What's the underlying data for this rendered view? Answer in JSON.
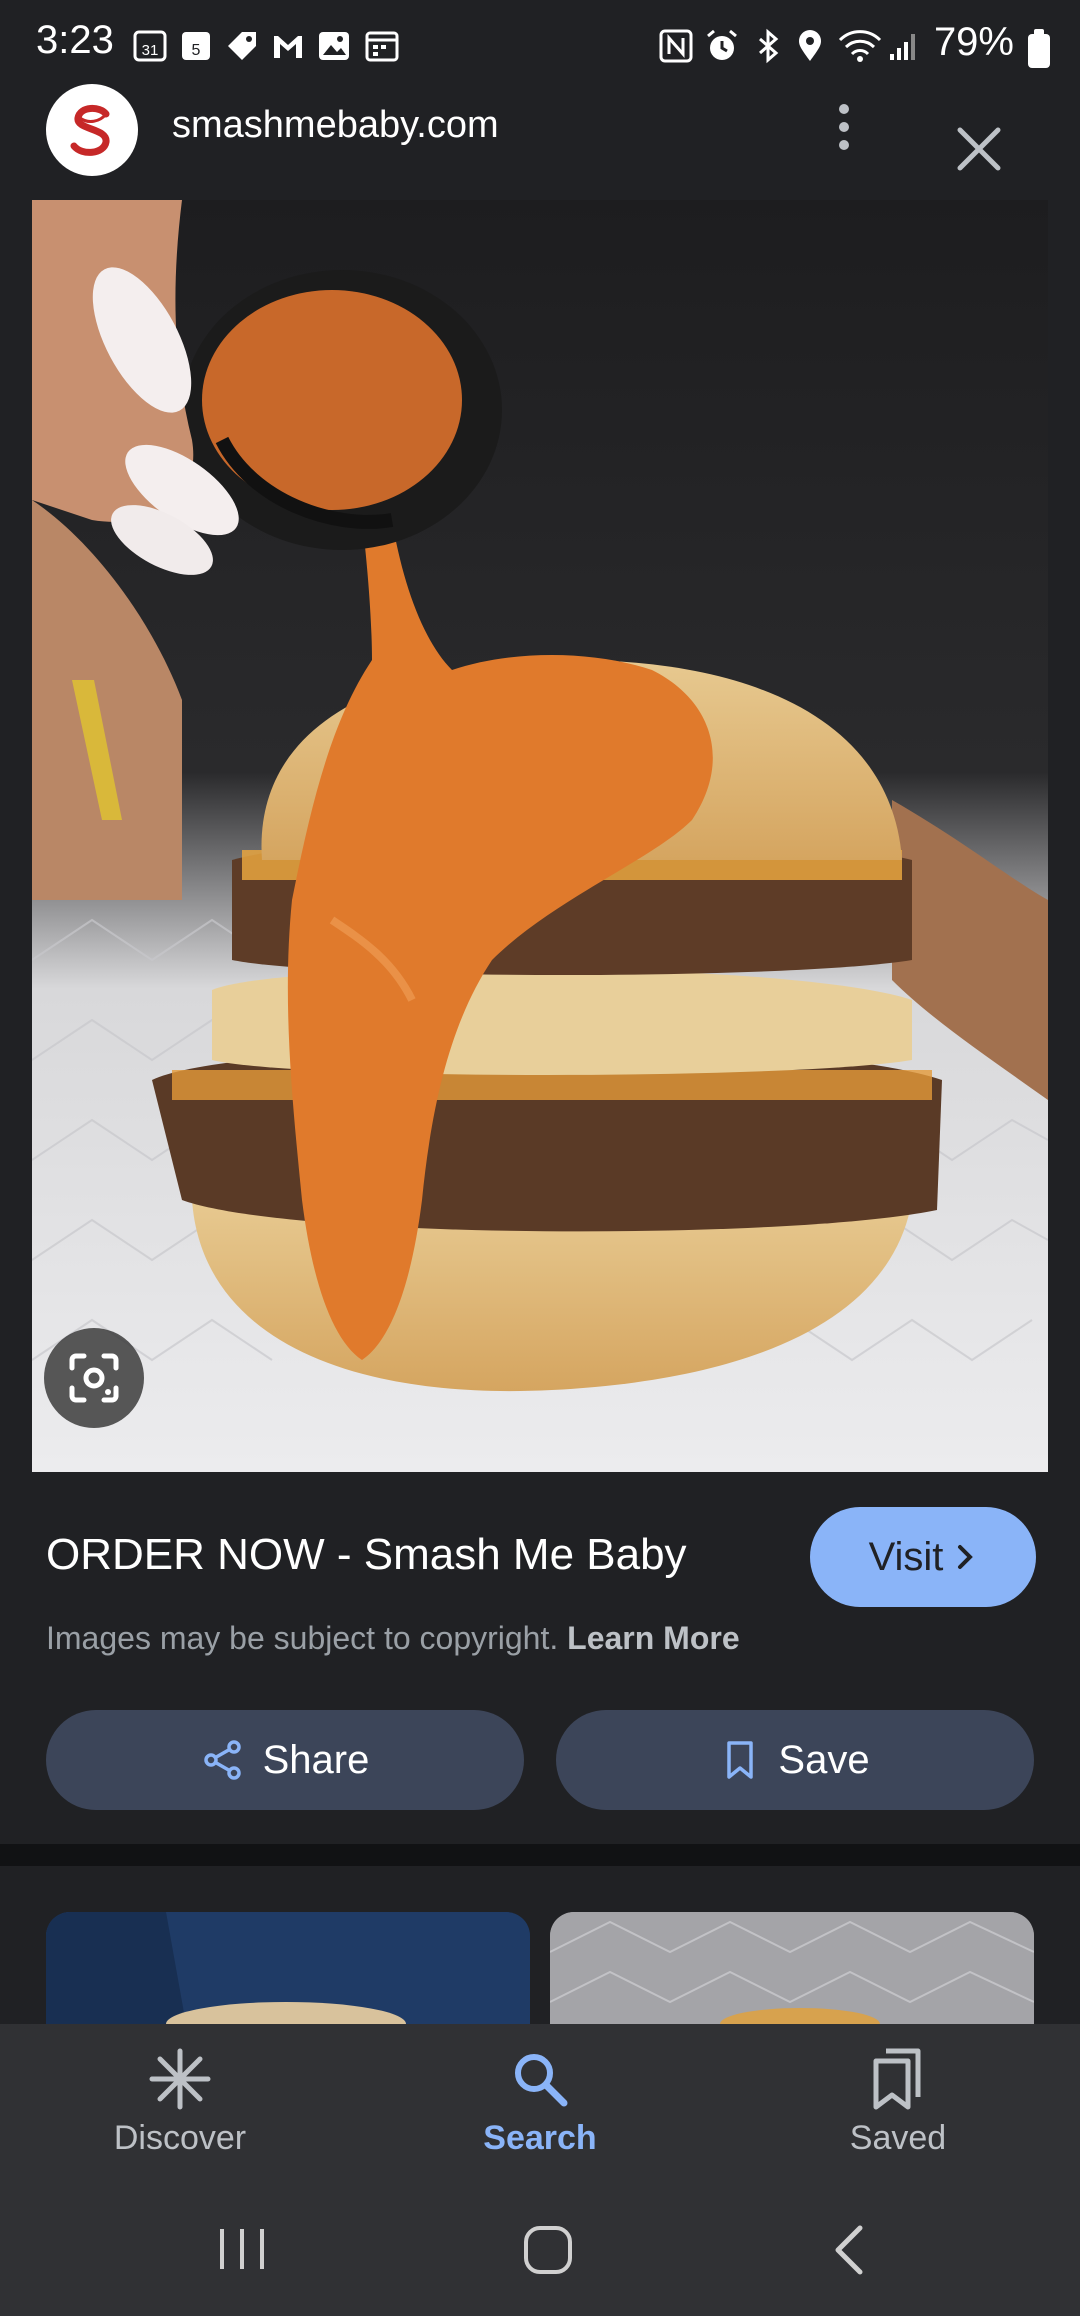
{
  "status_bar": {
    "time": "3:23",
    "battery": "79%",
    "left_icons": [
      "calendar-icon",
      "calendar-5-icon",
      "tag-icon",
      "gmail-icon",
      "gallery-icon",
      "calendar-alt-icon"
    ],
    "right_icons": [
      "nfc-icon",
      "alarm-icon",
      "bluetooth-icon",
      "location-icon",
      "wifi-icon",
      "signal-icon",
      "battery-icon"
    ]
  },
  "header": {
    "site": "smashmebaby.com",
    "logo_letter": "S"
  },
  "result": {
    "title": "ORDER NOW - Smash Me Baby",
    "visit_label": "Visit",
    "copyright": "Images may be subject to copyright.",
    "learn_more": "Learn More",
    "share_label": "Share",
    "save_label": "Save"
  },
  "bottom_nav": {
    "items": [
      {
        "label": "Discover",
        "icon": "asterisk-icon",
        "active": false
      },
      {
        "label": "Search",
        "icon": "search-icon",
        "active": true
      },
      {
        "label": "Saved",
        "icon": "bookmarks-icon",
        "active": false
      }
    ]
  },
  "colors": {
    "background": "#202124",
    "accent": "#8ab4f8",
    "pill": "#3c4559",
    "nav": "#303134"
  }
}
